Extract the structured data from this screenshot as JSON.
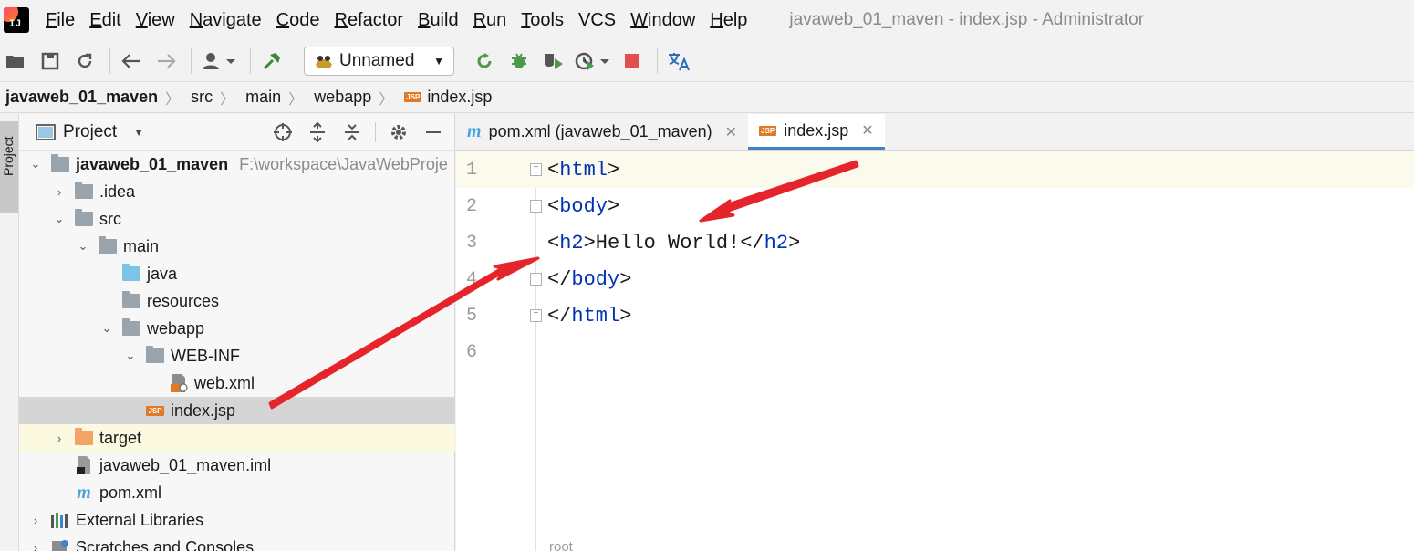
{
  "menubar": {
    "items": [
      {
        "accel": "F",
        "rest": "ile"
      },
      {
        "accel": "E",
        "rest": "dit"
      },
      {
        "accel": "V",
        "rest": "iew"
      },
      {
        "accel": "N",
        "rest": "avigate"
      },
      {
        "accel": "C",
        "rest": "ode"
      },
      {
        "accel": "R",
        "rest": "efactor"
      },
      {
        "accel": "B",
        "rest": "uild"
      },
      {
        "accel": "R",
        "rest": "un"
      },
      {
        "accel": "T",
        "rest": "ools"
      },
      {
        "accel": "",
        "rest": "VCS"
      },
      {
        "accel": "W",
        "rest": "indow"
      },
      {
        "accel": "H",
        "rest": "elp"
      }
    ],
    "window_title": "javaweb_01_maven - index.jsp - Administrator"
  },
  "toolbar": {
    "run_config_label": "Unnamed"
  },
  "breadcrumb": {
    "items": [
      "javaweb_01_maven",
      "src",
      "main",
      "webapp",
      "index.jsp"
    ]
  },
  "side_stripe": {
    "label": "Project"
  },
  "project_panel": {
    "title": "Project",
    "tree": [
      {
        "label": "javaweb_01_maven",
        "path": "F:\\workspace\\JavaWebProje"
      },
      {
        "label": ".idea"
      },
      {
        "label": "src"
      },
      {
        "label": "main"
      },
      {
        "label": "java"
      },
      {
        "label": "resources"
      },
      {
        "label": "webapp"
      },
      {
        "label": "WEB-INF"
      },
      {
        "label": "web.xml"
      },
      {
        "label": "index.jsp"
      },
      {
        "label": "target"
      },
      {
        "label": "javaweb_01_maven.iml"
      },
      {
        "label": "pom.xml"
      },
      {
        "label": "External Libraries"
      },
      {
        "label": "Scratches and Consoles"
      }
    ]
  },
  "editor": {
    "tabs": [
      {
        "label": "pom.xml (javaweb_01_maven)"
      },
      {
        "label": "index.jsp"
      }
    ],
    "lines": [
      {
        "no": "1",
        "open": "<",
        "tag": "html",
        "close": ">",
        "rest": "",
        "tag2": "",
        "close2": ""
      },
      {
        "no": "2",
        "open": "<",
        "tag": "body",
        "close": ">",
        "rest": "",
        "tag2": "",
        "close2": ""
      },
      {
        "no": "3",
        "open": "<",
        "tag": "h2",
        "close": ">Hello World!</",
        "rest": "",
        "tag2": "h2",
        "close2": ">"
      },
      {
        "no": "4",
        "open": "</",
        "tag": "body",
        "close": ">",
        "rest": "",
        "tag2": "",
        "close2": ""
      },
      {
        "no": "5",
        "open": "</",
        "tag": "html",
        "close": ">",
        "rest": "",
        "tag2": "",
        "close2": ""
      },
      {
        "no": "6",
        "open": "",
        "tag": "",
        "close": "",
        "rest": "",
        "tag2": "",
        "close2": ""
      }
    ],
    "status_path": "root"
  },
  "colors": {
    "accent": "#4083c9",
    "tag": "#0033b3",
    "annotation_arrow": "#e5242b"
  }
}
